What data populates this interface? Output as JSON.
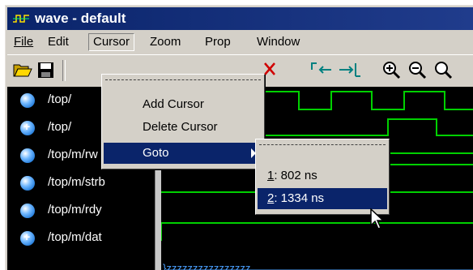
{
  "window": {
    "title": "wave - default"
  },
  "menubar": {
    "items": [
      {
        "key": "file",
        "label": "File"
      },
      {
        "key": "edit",
        "label": "Edit"
      },
      {
        "key": "cursor",
        "label": "Cursor"
      },
      {
        "key": "zoom",
        "label": "Zoom"
      },
      {
        "key": "prop",
        "label": "Prop"
      },
      {
        "key": "window",
        "label": "Window"
      }
    ]
  },
  "toolbar": {
    "buttons": [
      {
        "icon": "open-folder-icon"
      },
      {
        "icon": "save-icon"
      },
      {
        "icon": "delete-cursor-icon"
      },
      {
        "icon": "find-previous-transition-icon"
      },
      {
        "icon": "find-next-transition-icon"
      },
      {
        "icon": "zoom-in-icon"
      },
      {
        "icon": "zoom-out-icon"
      },
      {
        "icon": "zoom-full-icon"
      }
    ]
  },
  "signals": [
    {
      "name": "/top/"
    },
    {
      "name": "/top/"
    },
    {
      "name": "/top/m/rw"
    },
    {
      "name": "/top/m/strb"
    },
    {
      "name": "/top/m/rdy"
    },
    {
      "name": "/top/m/dat"
    }
  ],
  "wave": {
    "data_bus_text": "}zzzzzzzzzzzzzzzz",
    "colors": {
      "signal": "#00d000",
      "background": "#000000",
      "bus": "#4aa0ff"
    }
  },
  "cursor_menu": {
    "items": [
      {
        "label": "Add Cursor"
      },
      {
        "label": "Delete Cursor"
      },
      {
        "label": "Goto"
      }
    ]
  },
  "goto_submenu": {
    "items": [
      {
        "index": "1",
        "value": ": 802 ns"
      },
      {
        "index": "2",
        "value": ": 1334 ns"
      }
    ]
  }
}
